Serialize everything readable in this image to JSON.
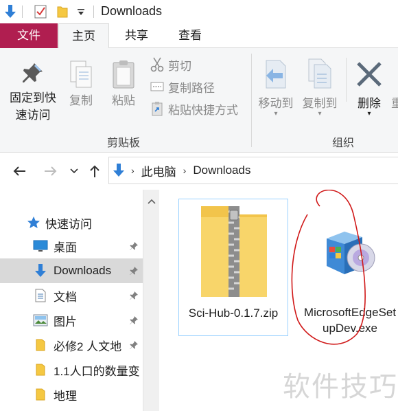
{
  "window": {
    "title": "Downloads"
  },
  "ribbon": {
    "tabs": {
      "file": "文件",
      "home": "主页",
      "share": "共享",
      "view": "查看"
    },
    "clipboard": {
      "pin_label_line1": "固定到快",
      "pin_label_line2": "速访问",
      "copy": "复制",
      "paste": "粘贴",
      "cut": "剪切",
      "copy_path": "复制路径",
      "paste_shortcut": "粘贴快捷方式",
      "group_label": "剪贴板"
    },
    "organize": {
      "move_to": "移动到",
      "copy_to": "复制到",
      "delete": "删除",
      "rename_partial": "重",
      "group_label": "组织"
    }
  },
  "address": {
    "segments": [
      "此电脑",
      "Downloads"
    ]
  },
  "nav": {
    "quick_access": "快速访问",
    "items": [
      {
        "label": "桌面",
        "icon": "desktop-icon",
        "pinned": true
      },
      {
        "label": "Downloads",
        "icon": "download-arrow-icon",
        "pinned": true,
        "selected": true
      },
      {
        "label": "文档",
        "icon": "document-icon",
        "pinned": true
      },
      {
        "label": "图片",
        "icon": "picture-icon",
        "pinned": true
      },
      {
        "label": "必修2 人文地",
        "icon": "folder-icon",
        "pinned": true
      },
      {
        "label": "1.1人口的数量变",
        "icon": "folder-icon",
        "pinned": false
      },
      {
        "label": "地理",
        "icon": "folder-icon",
        "pinned": false
      }
    ]
  },
  "files": [
    {
      "name": "Sci-Hub-0.1.7.zip",
      "icon": "zip-folder-icon",
      "selected": true
    },
    {
      "name": "MicrosoftEdgeSetupDev.exe",
      "icon": "installer-icon",
      "selected": false
    }
  ],
  "watermark": "软件技巧",
  "colors": {
    "file_tab": "#b01e50",
    "selection": "#d9d9d9",
    "file_selected_border": "#99d1ff",
    "annotation": "#d01818"
  }
}
